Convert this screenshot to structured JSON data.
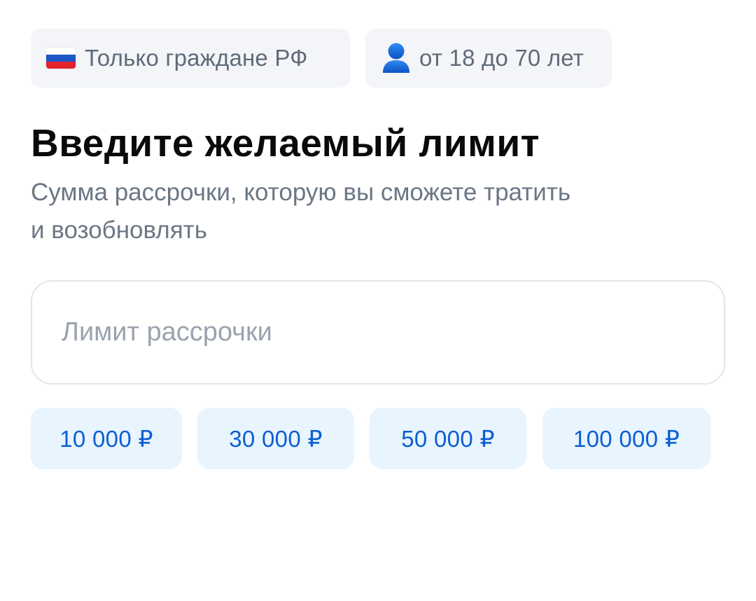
{
  "requirements": {
    "citizenship": {
      "icon": "russian-flag-icon",
      "label": "Только граждане РФ"
    },
    "age": {
      "icon": "person-icon",
      "label": "от 18 до 70 лет"
    }
  },
  "limit_section": {
    "title": "Введите желаемый лимит",
    "subtitle_line1": "Сумма рассрочки, которую вы сможете тратить",
    "subtitle_line2": "и возобновлять",
    "input": {
      "value": "",
      "placeholder": "Лимит рассрочки"
    },
    "presets": [
      {
        "label": "10 000 ₽"
      },
      {
        "label": "30 000 ₽"
      },
      {
        "label": "50 000 ₽"
      },
      {
        "label": "100 000 ₽"
      }
    ]
  },
  "colors": {
    "chip_background": "#f3f5f8",
    "preset_background": "#e8f4fe",
    "preset_text": "#0c5fd1",
    "accent_blue": "#1a6fe0"
  }
}
